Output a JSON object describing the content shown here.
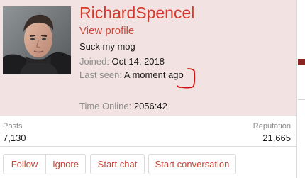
{
  "profile": {
    "username": "RichardSpencel",
    "view_profile_label": "View profile",
    "status": "Suck my mog",
    "joined_label": "Joined:",
    "joined_value": "Oct 14, 2018",
    "last_seen_label": "Last seen:",
    "last_seen_value": "A moment ago",
    "time_online_label": "Time Online:",
    "time_online_value": "2056:42"
  },
  "stats": {
    "posts_label": "Posts",
    "posts_value": "7,130",
    "reputation_label": "Reputation",
    "reputation_value": "21,665"
  },
  "actions": {
    "follow_label": "Follow",
    "ignore_label": "Ignore",
    "start_chat_label": "Start chat",
    "start_conversation_label": "Start conversation"
  },
  "colors": {
    "username": "#d33a2c",
    "card_background": "#f3e2e2",
    "annotation_mark": "#d01010"
  },
  "annotation": {
    "type": "hand-drawn red bracket around last seen value"
  }
}
